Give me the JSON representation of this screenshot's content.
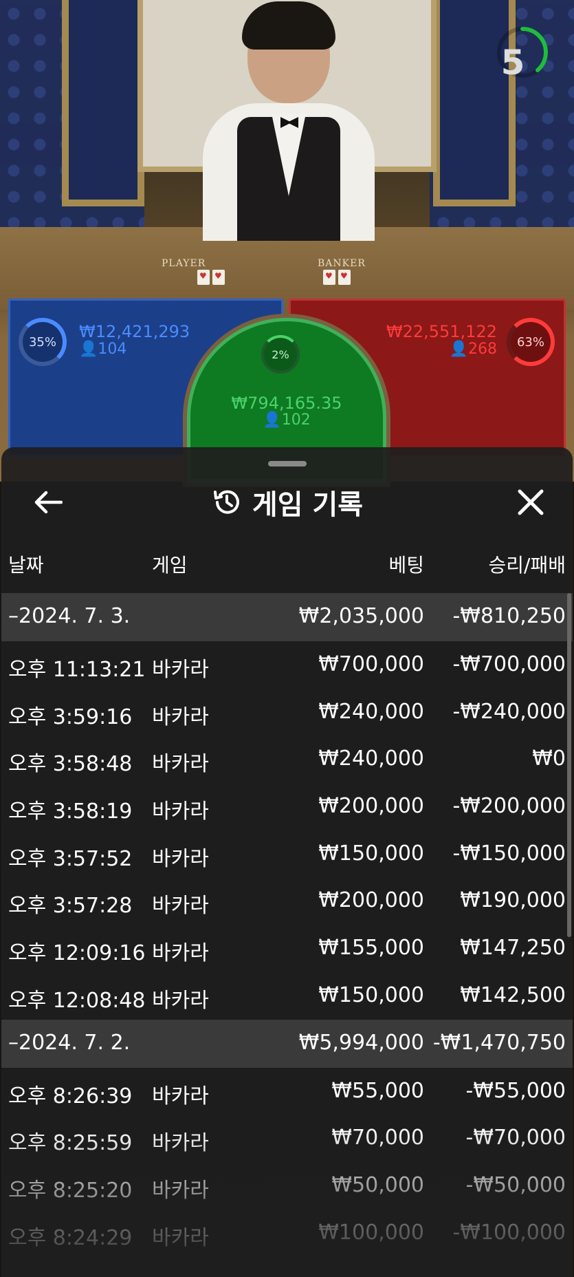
{
  "table": {
    "player_label": "PLAYER",
    "banker_label": "BANKER",
    "timer": "5"
  },
  "bets": {
    "player": {
      "percent": "35%",
      "amount": "₩12,421,293",
      "count": "104"
    },
    "tie": {
      "percent": "2%",
      "amount": "₩794,165.35",
      "count": "102"
    },
    "banker": {
      "percent": "63%",
      "amount": "₩22,551,122",
      "count": "268"
    }
  },
  "history": {
    "title": "게임 기록",
    "columns": {
      "date": "날짜",
      "game": "게임",
      "bet": "베팅",
      "result": "승리/패배"
    },
    "groups": [
      {
        "date": "–2024. 7. 3.",
        "bet": "₩2,035,000",
        "result": "-₩810,250",
        "rows": [
          {
            "time": "오후 11:13:21",
            "game": "바카라",
            "bet": "₩700,000",
            "result": "-₩700,000"
          },
          {
            "time": "오후 3:59:16",
            "game": "바카라",
            "bet": "₩240,000",
            "result": "-₩240,000"
          },
          {
            "time": "오후 3:58:48",
            "game": "바카라",
            "bet": "₩240,000",
            "result": "₩0"
          },
          {
            "time": "오후 3:58:19",
            "game": "바카라",
            "bet": "₩200,000",
            "result": "-₩200,000"
          },
          {
            "time": "오후 3:57:52",
            "game": "바카라",
            "bet": "₩150,000",
            "result": "-₩150,000"
          },
          {
            "time": "오후 3:57:28",
            "game": "바카라",
            "bet": "₩200,000",
            "result": "₩190,000"
          },
          {
            "time": "오후 12:09:16",
            "game": "바카라",
            "bet": "₩155,000",
            "result": "₩147,250"
          },
          {
            "time": "오후 12:08:48",
            "game": "바카라",
            "bet": "₩150,000",
            "result": "₩142,500"
          }
        ]
      },
      {
        "date": "–2024. 7. 2.",
        "bet": "₩5,994,000",
        "result": "-₩1,470,750",
        "rows": [
          {
            "time": "오후 8:26:39",
            "game": "바카라",
            "bet": "₩55,000",
            "result": "-₩55,000"
          },
          {
            "time": "오후 8:25:59",
            "game": "바카라",
            "bet": "₩70,000",
            "result": "-₩70,000"
          },
          {
            "time": "오후 8:25:20",
            "game": "바카라",
            "bet": "₩50,000",
            "result": "-₩50,000"
          },
          {
            "time": "오후 8:24:29",
            "game": "바카라",
            "bet": "₩100,000",
            "result": "-₩100,000"
          }
        ]
      }
    ]
  },
  "colors": {
    "player": "#4a8cff",
    "banker": "#ff3b3b",
    "tie": "#4bd36a"
  }
}
